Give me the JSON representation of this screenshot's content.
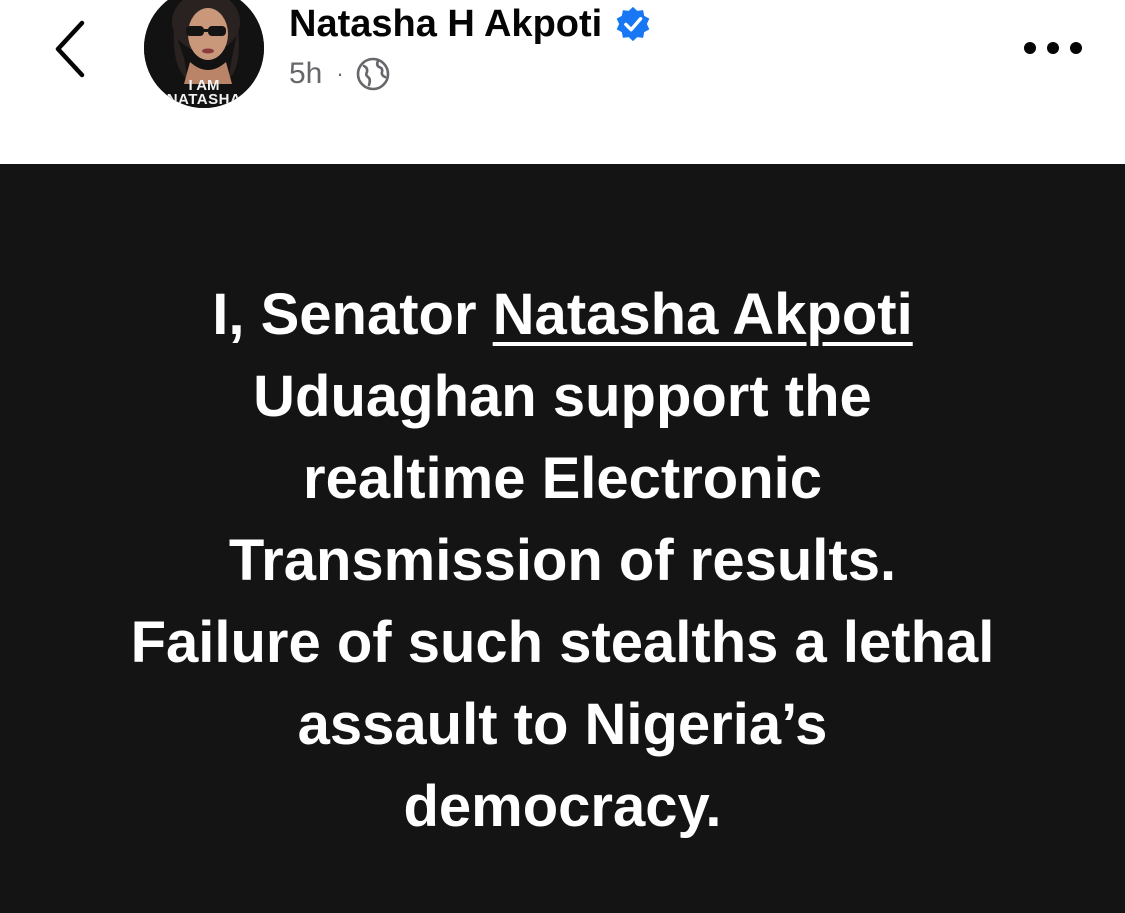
{
  "header": {
    "back_icon": "chevron-left-icon",
    "author_name": "Natasha H Akpoti",
    "verified_icon": "verified-badge-icon",
    "verified_color": "#1877f2",
    "avatar_caption_line1": "I AM",
    "avatar_caption_line2": "NATASHA",
    "timestamp": "5h",
    "separator": "·",
    "audience_icon": "globe-icon",
    "more_icon": "more-dots-icon"
  },
  "post": {
    "background_color": "#141414",
    "text_color": "#ffffff",
    "line1_prefix": "I, Senator ",
    "line1_tag": "Natasha Akpoti",
    "line2": "Uduaghan support the",
    "line3": "realtime Electronic",
    "line4": "Transmission of results.",
    "line5": "Failure of such stealths a lethal",
    "line6": "assault to Nigeria’s",
    "line7": "democracy."
  }
}
